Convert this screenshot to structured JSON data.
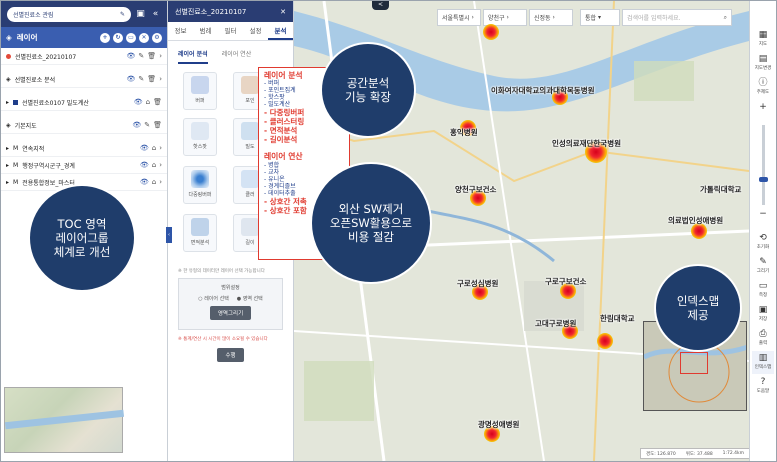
{
  "left_panel": {
    "project_name": "선별진료소 관림",
    "layer_title": "레이어",
    "layers": [
      {
        "label": "선별진료소_20210107",
        "kind": "point"
      },
      {
        "label": "선별진료소 분석",
        "kind": "group"
      },
      {
        "label": "선별진료소0107 밀도계산",
        "kind": "square"
      },
      {
        "label": "기본지도",
        "kind": "group"
      },
      {
        "label": "연속지적",
        "kind": "M"
      },
      {
        "label": "행정구역시군구_경계",
        "kind": "M"
      },
      {
        "label": "전용통합정보_마스터",
        "kind": "M"
      }
    ]
  },
  "mid_panel": {
    "title": "선별진료소_20210107",
    "tabs": [
      "정보",
      "범례",
      "필터",
      "설정",
      "분석"
    ],
    "subtabs": [
      "레이어 분석",
      "레이어 연산"
    ],
    "tools": [
      "버퍼",
      "포인",
      "핫스팟",
      "밀도",
      "다중링버퍼",
      "클러",
      "면적분석",
      "길이"
    ],
    "note": "※ 한 유형의 데이터만 레이어 선택 가능합니다",
    "range_title": "범위설정",
    "radio": [
      "레이어 선택",
      "영역 선택"
    ],
    "draw_button": "영역그리기",
    "warning": "※ 통계/연산 시 시간이 많이 소요될 수 있습니다",
    "run_button": "수행"
  },
  "map": {
    "search": {
      "sido": "서울특별시",
      "sigungu": "양천구",
      "dong": "신정동",
      "select": "통합",
      "placeholder": "검색어를 입력하세요."
    },
    "top_badge": "<",
    "places": [
      {
        "label": "이화여자대학교의과대학목동병원"
      },
      {
        "label": "홍익병원"
      },
      {
        "label": "인성의료재단한국병원"
      },
      {
        "label": "양천구보건소"
      },
      {
        "label": "가톨릭대학교"
      },
      {
        "label": "의료법인성애병원"
      },
      {
        "label": "구로성심병원"
      },
      {
        "label": "구로구보건소"
      },
      {
        "label": "고대구로병원"
      },
      {
        "label": "한림대학교"
      },
      {
        "label": "광명성애병원"
      }
    ],
    "scale": [
      "경도: 126.870",
      "위도: 37.488",
      "1:72.4km"
    ]
  },
  "callout": {
    "analysis_title": "레이어 분석",
    "analysis_items": [
      "- 버퍼",
      "- 포인트집계",
      "- 핫스팟",
      "- 밀도계산"
    ],
    "analysis_red": [
      "- 다중링버퍼",
      "- 클러스터링",
      "- 면적분석",
      "- 길이분석"
    ],
    "ops_title": "레이어 연산",
    "ops_items": [
      "- 병합",
      "- 교차",
      "- 유니온",
      "- 경계디졸브",
      "- 데이터추출"
    ],
    "ops_red": [
      "- 상호간 저촉",
      "- 상호간 포함"
    ]
  },
  "circles": {
    "toc": [
      "TOC 영역",
      "레이어그룹",
      "체계로 개선"
    ],
    "spatial": [
      "공간분석",
      "기능 확장"
    ],
    "sw": [
      "외산 SW제거",
      "오픈SW활용으로",
      "비용 절감"
    ],
    "inset": [
      "인덱스맵",
      "제공"
    ]
  },
  "right_toolbar": [
    "지도",
    "지도변경",
    "주제도",
    "",
    "",
    "",
    "초기화",
    "그리기",
    "측정",
    "저장",
    "출력",
    "인덱스맵",
    "도움말"
  ],
  "colors": {
    "navy": "#2a3d73",
    "accent_red": "#e03a2f",
    "circle": "#1f3d6b",
    "layer_head": "#3a5eb0"
  }
}
